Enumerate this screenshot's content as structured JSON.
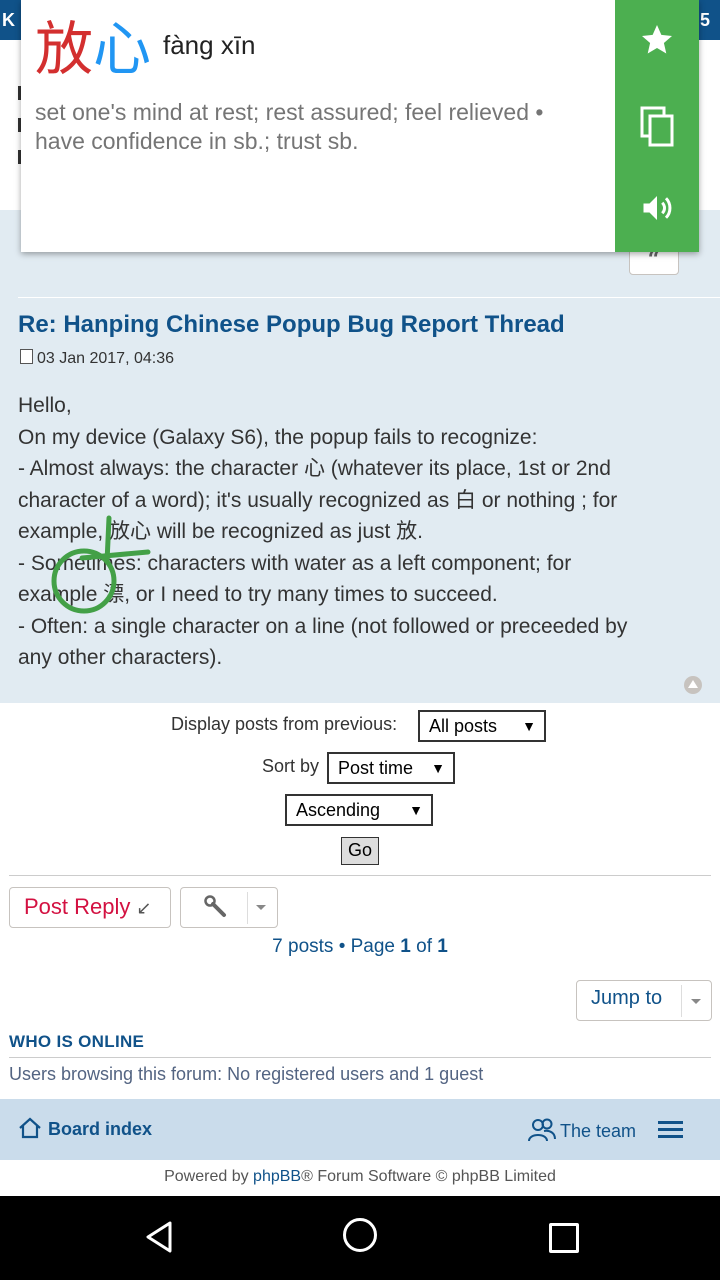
{
  "popup": {
    "char1": "放",
    "char2": "心",
    "pinyin": "fàng xīn",
    "definition_line1": "set one's mind at rest; rest assured; feel relieved •",
    "definition_line2": "have confidence in sb.; trust sb.",
    "actions": [
      "star-icon",
      "copy-icon",
      "speaker-icon"
    ],
    "colors": {
      "char1": "#d32f2f",
      "char2": "#2196f3",
      "action_bar": "#4caf50"
    }
  },
  "post": {
    "title": "Re: Hanping Chinese Popup Bug Report Thread",
    "date": "03 Jan 2017, 04:36",
    "lines": [
      "Hello,",
      "On my device (Galaxy S6), the popup fails to recognize:",
      "- Almost always: the character 心 (whatever its place, 1st or 2nd",
      "character of a word); it's usually recognized as 白 or nothing ; for",
      "example, 放心 will be recognized as just 放.",
      "- Sometimes: characters with water as a left component; for",
      "example 漂, or I need to try many times to succeed.",
      "- Often: a single character on a line (not followed or preceeded by",
      "any other characters)."
    ],
    "quote_label": "“"
  },
  "filters": {
    "display_label": "Display posts from previous:",
    "display_value": "All posts",
    "sort_label": "Sort by",
    "sort_value": "Post time",
    "order_value": "Ascending",
    "go_label": "Go",
    "arrow": "▼"
  },
  "actions": {
    "reply_label": "Post Reply",
    "jump_label": "Jump to"
  },
  "pagination": {
    "prefix": "7 posts • Page ",
    "current": "1",
    "middle": " of ",
    "total": "1"
  },
  "online": {
    "title": "WHO IS ONLINE",
    "text": "Users browsing this forum: No registered users and 1 guest"
  },
  "footer": {
    "board_index": "Board index",
    "team": "The team",
    "powered_prefix": "Powered by ",
    "powered_link": "phpBB",
    "powered_suffix": "® Forum Software © phpBB Limited"
  },
  "header": {
    "left_text": "K",
    "right_text": "5"
  },
  "colors": {
    "header": "#105289",
    "post_bg": "#e1ebf2",
    "footer_nav": "#cadceb",
    "reply_text": "#d31141"
  }
}
